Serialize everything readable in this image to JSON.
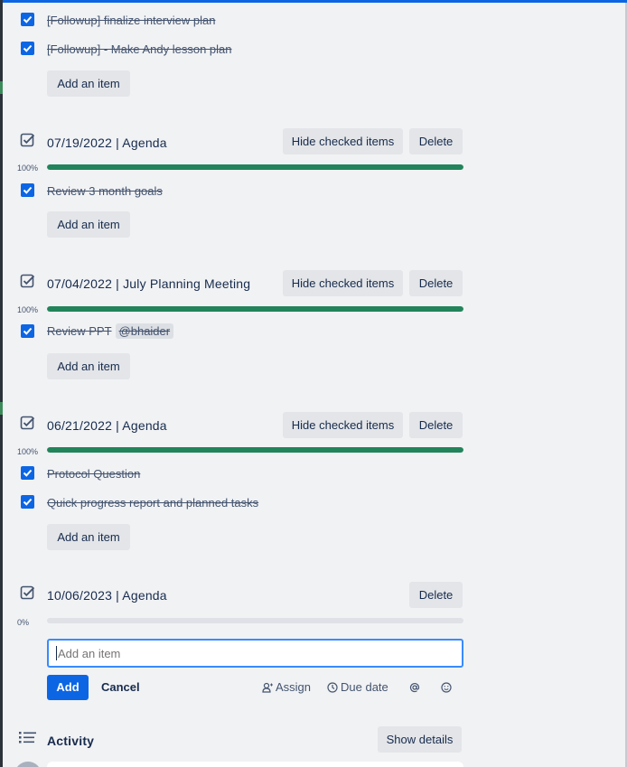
{
  "checklists": {
    "followups": {
      "items": [
        {
          "text": "[Followup] finalize interview plan",
          "checked": true
        },
        {
          "text": "[Followup] - Make Andy lesson plan",
          "checked": true
        }
      ],
      "add_item_label": "Add an item"
    },
    "agenda_0719": {
      "title": "07/19/2022 | Agenda",
      "hide_checked_label": "Hide checked items",
      "delete_label": "Delete",
      "progress_text": "100%",
      "progress": 1.0,
      "items": [
        {
          "text": "Review 3 month goals",
          "checked": true
        }
      ],
      "add_item_label": "Add an item"
    },
    "planning_0704": {
      "title": "07/04/2022 | July Planning Meeting",
      "hide_checked_label": "Hide checked items",
      "delete_label": "Delete",
      "progress_text": "100%",
      "progress": 1.0,
      "items": [
        {
          "text": "Review PPT",
          "mention": "@bhaider",
          "checked": true
        }
      ],
      "add_item_label": "Add an item"
    },
    "agenda_0621": {
      "title": "06/21/2022 | Agenda",
      "hide_checked_label": "Hide checked items",
      "delete_label": "Delete",
      "progress_text": "100%",
      "progress": 1.0,
      "items": [
        {
          "text": "Protocol Question",
          "checked": true
        },
        {
          "text": "Quick progress report and planned tasks",
          "checked": true
        }
      ],
      "add_item_label": "Add an item"
    },
    "agenda_1006": {
      "title": "10/06/2023 | Agenda",
      "delete_label": "Delete",
      "progress_text": "0%",
      "progress": 0.0,
      "new_item_placeholder": "Add an item",
      "add_label": "Add",
      "cancel_label": "Cancel",
      "assign_label": "Assign",
      "due_date_label": "Due date"
    }
  },
  "activity": {
    "title": "Activity",
    "show_details_label": "Show details"
  },
  "colors": {
    "accent": "#0c66e4",
    "progress_complete": "#22845a",
    "background": "#f1f2f4",
    "button": "#e3e5e8"
  },
  "icons": [
    "checkbox-checked-icon",
    "checklist-icon",
    "assign-icon",
    "clock-icon",
    "mention-icon",
    "emoji-icon",
    "activity-list-icon"
  ]
}
